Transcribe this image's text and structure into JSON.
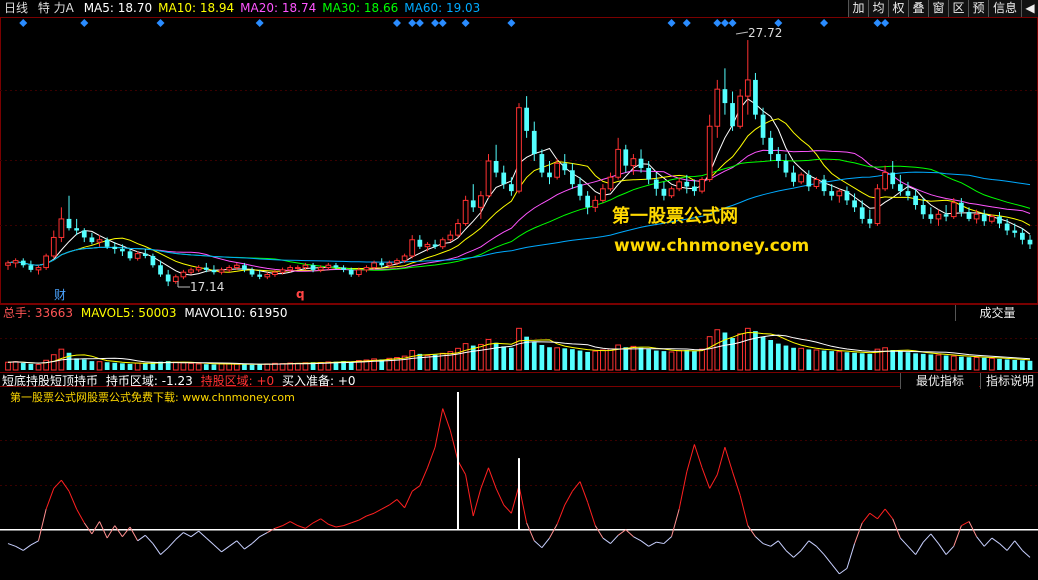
{
  "header": {
    "period": "日线",
    "stock": "特 力A",
    "ma": [
      {
        "label": "MA5: 18.70",
        "color": "#ffffff"
      },
      {
        "label": "MA10: 18.94",
        "color": "#ffff00"
      },
      {
        "label": "MA20: 18.74",
        "color": "#ff55ff"
      },
      {
        "label": "MA30: 18.66",
        "color": "#00ff00"
      },
      {
        "label": "MA60: 19.03",
        "color": "#00aaff"
      }
    ]
  },
  "toolbar": [
    "加",
    "均",
    "权",
    "叠",
    "窗",
    "区",
    "预",
    "信息"
  ],
  "annotations": {
    "high": "27.72",
    "low": "17.14",
    "mark_cai": "财",
    "mark_q": "q"
  },
  "watermark": {
    "line1": "第一股票公式网",
    "line2": "www.chnmoney.com"
  },
  "volume_header": {
    "total_label": "总手:",
    "total_value": "33663",
    "mavol5": "MAVOL5: 50003",
    "mavol10": "MAVOL10: 61950",
    "button": "成交量"
  },
  "indicator_header": {
    "name": "短底持股短顶持币",
    "hold_coin": "持币区域: -1.23",
    "hold_stock": "持股区域: +0",
    "buy_ready": "买入准备: +0",
    "btn_best": "最优指标",
    "btn_help": "指标说明",
    "note": "第一股票公式网股票公式免费下载: www.chnmoney.com"
  },
  "chart_data": {
    "type": "candlestick",
    "ylim": [
      16.5,
      28.5
    ],
    "candles": [
      [
        18.0,
        18.2,
        17.8,
        18.1
      ],
      [
        18.1,
        18.3,
        17.9,
        18.2
      ],
      [
        18.2,
        18.3,
        17.9,
        18.0
      ],
      [
        18.0,
        18.2,
        17.7,
        17.8
      ],
      [
        17.8,
        18.0,
        17.6,
        17.9
      ],
      [
        17.9,
        18.5,
        17.8,
        18.4
      ],
      [
        18.4,
        19.5,
        18.3,
        19.2
      ],
      [
        19.2,
        20.5,
        19.0,
        20.0
      ],
      [
        20.0,
        21.0,
        19.5,
        19.6
      ],
      [
        19.6,
        20.0,
        19.3,
        19.5
      ],
      [
        19.5,
        19.6,
        19.0,
        19.2
      ],
      [
        19.2,
        19.4,
        18.9,
        19.0
      ],
      [
        19.0,
        19.3,
        18.8,
        19.1
      ],
      [
        19.1,
        19.2,
        18.7,
        18.8
      ],
      [
        18.8,
        19.0,
        18.5,
        18.7
      ],
      [
        18.7,
        18.9,
        18.4,
        18.6
      ],
      [
        18.6,
        18.7,
        18.2,
        18.3
      ],
      [
        18.3,
        18.6,
        18.2,
        18.5
      ],
      [
        18.5,
        18.7,
        18.3,
        18.4
      ],
      [
        18.4,
        18.5,
        17.9,
        18.0
      ],
      [
        18.0,
        18.2,
        17.5,
        17.6
      ],
      [
        17.6,
        17.8,
        17.1,
        17.3
      ],
      [
        17.3,
        17.6,
        17.2,
        17.5
      ],
      [
        17.5,
        17.8,
        17.4,
        17.7
      ],
      [
        17.7,
        17.9,
        17.6,
        17.8
      ],
      [
        17.8,
        18.0,
        17.7,
        17.9
      ],
      [
        17.9,
        18.1,
        17.7,
        17.8
      ],
      [
        17.8,
        18.0,
        17.6,
        17.7
      ],
      [
        17.7,
        17.9,
        17.6,
        17.8
      ],
      [
        17.8,
        18.0,
        17.7,
        17.9
      ],
      [
        17.9,
        18.1,
        17.8,
        18.0
      ],
      [
        18.0,
        18.1,
        17.7,
        17.8
      ],
      [
        17.8,
        17.9,
        17.5,
        17.6
      ],
      [
        17.6,
        17.8,
        17.4,
        17.5
      ],
      [
        17.5,
        17.7,
        17.4,
        17.6
      ],
      [
        17.6,
        17.8,
        17.5,
        17.7
      ],
      [
        17.7,
        17.9,
        17.6,
        17.8
      ],
      [
        17.8,
        18.0,
        17.7,
        17.9
      ],
      [
        17.9,
        18.0,
        17.8,
        17.9
      ],
      [
        17.9,
        18.1,
        17.8,
        18.0
      ],
      [
        18.0,
        18.1,
        17.7,
        17.8
      ],
      [
        17.8,
        18.0,
        17.7,
        17.9
      ],
      [
        17.9,
        18.1,
        17.8,
        18.0
      ],
      [
        18.0,
        18.1,
        17.8,
        17.9
      ],
      [
        17.9,
        18.0,
        17.7,
        17.8
      ],
      [
        17.8,
        17.9,
        17.5,
        17.6
      ],
      [
        17.6,
        17.9,
        17.5,
        17.8
      ],
      [
        17.8,
        18.0,
        17.7,
        17.9
      ],
      [
        17.9,
        18.2,
        17.8,
        18.1
      ],
      [
        18.1,
        18.3,
        17.9,
        18.0
      ],
      [
        18.0,
        18.2,
        17.9,
        18.1
      ],
      [
        18.1,
        18.3,
        18.0,
        18.2
      ],
      [
        18.2,
        18.5,
        18.1,
        18.4
      ],
      [
        18.4,
        19.3,
        18.3,
        19.1
      ],
      [
        19.1,
        19.3,
        18.7,
        18.8
      ],
      [
        18.8,
        19.0,
        18.6,
        18.9
      ],
      [
        18.9,
        19.1,
        18.7,
        18.8
      ],
      [
        18.8,
        19.2,
        18.7,
        19.1
      ],
      [
        19.1,
        19.5,
        19.0,
        19.3
      ],
      [
        19.3,
        20.0,
        19.2,
        19.8
      ],
      [
        19.8,
        21.0,
        19.7,
        20.8
      ],
      [
        20.8,
        21.5,
        20.3,
        20.5
      ],
      [
        20.5,
        21.2,
        20.0,
        21.0
      ],
      [
        21.0,
        22.8,
        20.9,
        22.5
      ],
      [
        22.5,
        23.2,
        21.8,
        22.0
      ],
      [
        22.0,
        22.3,
        21.3,
        21.5
      ],
      [
        21.5,
        21.8,
        21.0,
        21.2
      ],
      [
        21.2,
        25.0,
        21.1,
        24.8
      ],
      [
        24.8,
        25.3,
        23.5,
        23.8
      ],
      [
        23.8,
        24.2,
        22.5,
        22.8
      ],
      [
        22.8,
        23.0,
        21.8,
        22.0
      ],
      [
        22.0,
        22.5,
        21.5,
        21.8
      ],
      [
        21.8,
        22.6,
        21.7,
        22.4
      ],
      [
        22.4,
        22.8,
        21.9,
        22.1
      ],
      [
        22.1,
        22.4,
        21.3,
        21.5
      ],
      [
        21.5,
        21.8,
        20.8,
        21.0
      ],
      [
        21.0,
        21.2,
        20.2,
        20.5
      ],
      [
        20.5,
        21.0,
        20.3,
        20.8
      ],
      [
        20.8,
        21.5,
        20.7,
        21.3
      ],
      [
        21.3,
        22.0,
        21.2,
        21.8
      ],
      [
        21.8,
        23.5,
        21.7,
        23.0
      ],
      [
        23.0,
        23.2,
        22.0,
        22.3
      ],
      [
        22.3,
        22.8,
        21.9,
        22.6
      ],
      [
        22.6,
        23.0,
        22.0,
        22.2
      ],
      [
        22.2,
        22.5,
        21.5,
        21.7
      ],
      [
        21.7,
        22.0,
        21.0,
        21.3
      ],
      [
        21.3,
        21.6,
        20.8,
        21.0
      ],
      [
        21.0,
        21.4,
        20.9,
        21.3
      ],
      [
        21.3,
        21.8,
        21.2,
        21.6
      ],
      [
        21.6,
        21.9,
        21.1,
        21.4
      ],
      [
        21.4,
        21.7,
        21.0,
        21.2
      ],
      [
        21.2,
        21.8,
        21.1,
        21.7
      ],
      [
        21.7,
        24.5,
        21.6,
        24.0
      ],
      [
        24.0,
        26.0,
        23.5,
        25.6
      ],
      [
        25.6,
        26.5,
        24.5,
        25.0
      ],
      [
        25.0,
        25.5,
        23.8,
        24.0
      ],
      [
        24.0,
        25.6,
        23.9,
        25.3
      ],
      [
        25.3,
        27.72,
        24.5,
        26.0
      ],
      [
        26.0,
        26.3,
        24.3,
        24.5
      ],
      [
        24.5,
        24.8,
        23.2,
        23.5
      ],
      [
        23.5,
        23.8,
        22.5,
        22.8
      ],
      [
        22.8,
        23.1,
        22.2,
        22.5
      ],
      [
        22.5,
        22.8,
        21.8,
        22.0
      ],
      [
        22.0,
        22.3,
        21.4,
        21.6
      ],
      [
        21.6,
        22.0,
        21.5,
        21.9
      ],
      [
        21.9,
        22.1,
        21.2,
        21.4
      ],
      [
        21.4,
        21.8,
        21.3,
        21.7
      ],
      [
        21.7,
        21.9,
        21.0,
        21.2
      ],
      [
        21.2,
        21.5,
        20.8,
        21.0
      ],
      [
        21.0,
        21.3,
        20.7,
        21.2
      ],
      [
        21.2,
        21.4,
        20.6,
        20.8
      ],
      [
        20.8,
        21.1,
        20.3,
        20.5
      ],
      [
        20.5,
        20.8,
        19.8,
        20.0
      ],
      [
        20.0,
        20.4,
        19.6,
        19.8
      ],
      [
        19.8,
        21.5,
        19.7,
        21.3
      ],
      [
        21.3,
        22.3,
        21.2,
        22.0
      ],
      [
        22.0,
        22.5,
        21.3,
        21.5
      ],
      [
        21.5,
        21.9,
        21.0,
        21.2
      ],
      [
        21.2,
        21.6,
        20.8,
        21.0
      ],
      [
        21.0,
        21.3,
        20.4,
        20.6
      ],
      [
        20.6,
        20.9,
        20.0,
        20.2
      ],
      [
        20.2,
        20.5,
        19.8,
        20.0
      ],
      [
        20.0,
        20.4,
        19.7,
        20.2
      ],
      [
        20.2,
        20.6,
        19.9,
        20.1
      ],
      [
        20.1,
        20.9,
        20.0,
        20.7
      ],
      [
        20.7,
        20.9,
        20.1,
        20.3
      ],
      [
        20.3,
        20.5,
        19.9,
        20.0
      ],
      [
        20.0,
        20.4,
        19.8,
        20.2
      ],
      [
        20.2,
        20.4,
        19.7,
        19.9
      ],
      [
        19.9,
        20.2,
        19.8,
        20.1
      ],
      [
        20.1,
        20.3,
        19.6,
        19.8
      ],
      [
        19.8,
        20.0,
        19.3,
        19.5
      ],
      [
        19.5,
        19.8,
        19.2,
        19.4
      ],
      [
        19.4,
        19.6,
        18.9,
        19.1
      ],
      [
        19.1,
        19.3,
        18.7,
        18.9
      ]
    ],
    "volume": [
      28,
      30,
      25,
      22,
      20,
      35,
      55,
      75,
      62,
      42,
      38,
      32,
      30,
      28,
      26,
      24,
      22,
      25,
      24,
      27,
      30,
      32,
      28,
      26,
      24,
      22,
      21,
      20,
      22,
      23,
      21,
      20,
      19,
      21,
      22,
      24,
      23,
      25,
      24,
      26,
      28,
      27,
      29,
      30,
      32,
      30,
      34,
      36,
      40,
      38,
      42,
      45,
      50,
      70,
      58,
      52,
      55,
      60,
      66,
      78,
      95,
      88,
      92,
      110,
      98,
      85,
      80,
      150,
      120,
      100,
      90,
      82,
      80,
      78,
      75,
      70,
      65,
      68,
      72,
      76,
      90,
      82,
      85,
      80,
      75,
      70,
      68,
      65,
      70,
      72,
      68,
      75,
      120,
      145,
      135,
      115,
      130,
      150,
      140,
      120,
      108,
      95,
      88,
      80,
      78,
      74,
      72,
      70,
      68,
      66,
      64,
      62,
      60,
      58,
      75,
      80,
      72,
      68,
      64,
      60,
      58,
      56,
      54,
      52,
      50,
      48,
      46,
      45,
      44,
      42,
      40,
      38,
      36,
      35,
      33
    ],
    "volume_ylim": [
      0,
      180
    ],
    "indicator": [
      -1.0,
      -1.2,
      -1.5,
      -1.1,
      -0.8,
      1.5,
      3.0,
      3.6,
      2.8,
      1.5,
      0.5,
      -0.3,
      0.6,
      -0.6,
      0.3,
      -0.5,
      0.2,
      -0.8,
      -0.4,
      -1.0,
      -1.8,
      -1.3,
      -0.7,
      -0.2,
      -0.5,
      -0.1,
      -0.6,
      -1.1,
      -1.6,
      -1.2,
      -0.8,
      -1.4,
      -1.0,
      -0.5,
      -0.2,
      0.1,
      0.3,
      0.6,
      0.3,
      0.1,
      0.5,
      0.8,
      0.4,
      0.2,
      0.3,
      0.5,
      0.7,
      1.0,
      1.2,
      1.5,
      1.8,
      2.2,
      1.6,
      2.8,
      3.2,
      4.5,
      6.0,
      8.8,
      7.2,
      5.0,
      4.0,
      1.0,
      3.0,
      4.5,
      3.0,
      1.8,
      1.2,
      3.2,
      0.5,
      -0.8,
      -1.3,
      -0.6,
      0.4,
      1.8,
      2.8,
      3.5,
      2.0,
      0.3,
      -0.6,
      -1.0,
      -0.4,
      0.0,
      -0.5,
      -0.8,
      -1.2,
      -0.9,
      -1.0,
      -0.5,
      1.5,
      4.2,
      6.2,
      4.5,
      3.0,
      4.0,
      6.0,
      4.2,
      2.5,
      0.3,
      -0.5,
      -1.0,
      -1.2,
      -0.8,
      -1.5,
      -2.0,
      -1.5,
      -0.8,
      -1.2,
      -1.8,
      -2.5,
      -3.2,
      -2.8,
      -1.0,
      0.5,
      1.2,
      0.8,
      1.5,
      0.8,
      -0.6,
      -1.2,
      -1.8,
      -0.9,
      -0.3,
      -1.0,
      -1.8,
      -1.2,
      0.3,
      0.6,
      -0.5,
      -1.2,
      -0.6,
      -1.0,
      -1.5,
      -0.8,
      -1.5,
      -2.0
    ],
    "indicator_ylim": [
      -3.5,
      10
    ],
    "indicator_spikes": [
      {
        "index": 59,
        "value": 10.0
      },
      {
        "index": 67,
        "value": 5.2
      }
    ]
  }
}
